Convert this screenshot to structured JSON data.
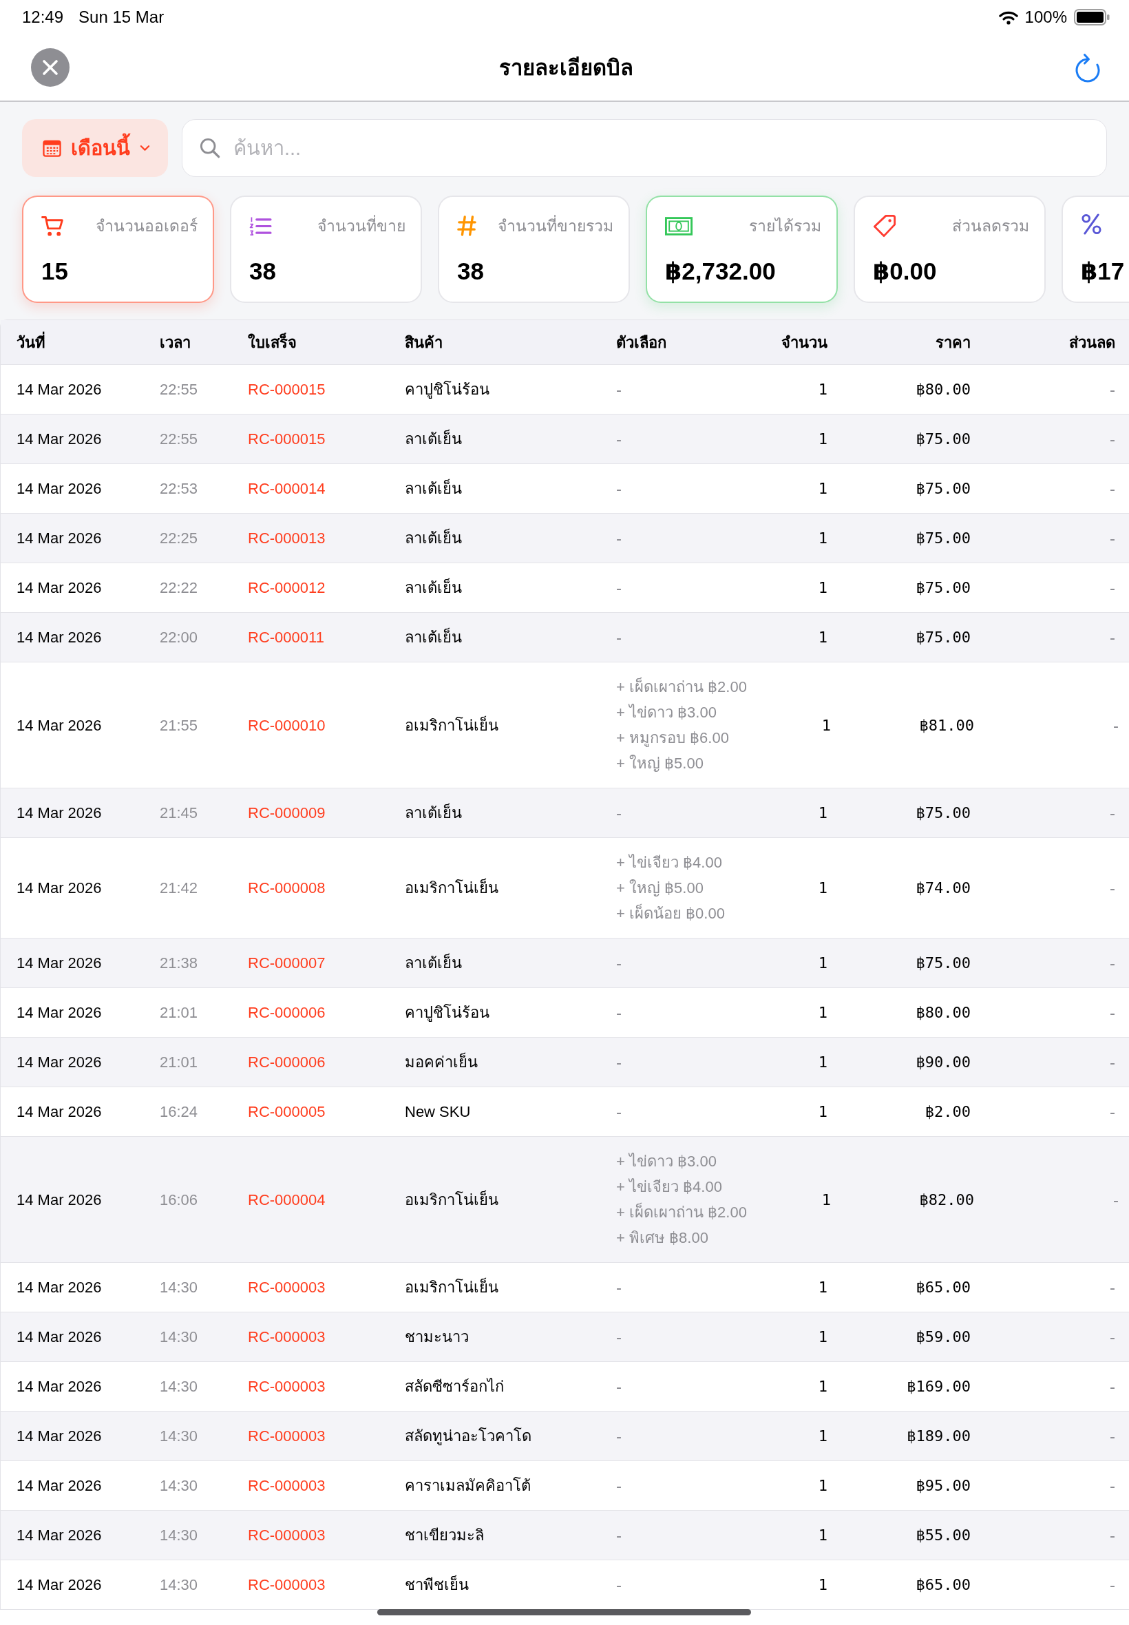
{
  "status_bar": {
    "time": "12:49",
    "date": "Sun 15 Mar",
    "battery": "100%"
  },
  "header": {
    "title": "รายละเอียดบิล"
  },
  "filter_button": {
    "label": "เดือนนี้"
  },
  "search": {
    "placeholder": "ค้นหา..."
  },
  "summary_cards": [
    {
      "kind": "cart",
      "label": "จำนวนออเดอร์",
      "value": "15",
      "color": "#ff3d1e",
      "highlighted": true
    },
    {
      "kind": "list",
      "label": "จำนวนที่ขาย",
      "value": "38",
      "color": "#af52de",
      "highlighted": false
    },
    {
      "kind": "hash",
      "label": "จำนวนที่ขายรวม",
      "value": "38",
      "color": "#ff9500",
      "highlighted": false
    },
    {
      "kind": "banknote",
      "label": "รายได้รวม",
      "value": "฿2,732.00",
      "color": "#34c759",
      "highlighted": true
    },
    {
      "kind": "tag",
      "label": "ส่วนลดรวม",
      "value": "฿0.00",
      "color": "#ff3b30",
      "highlighted": false
    },
    {
      "kind": "percent",
      "value": "฿17",
      "color": "#5856d6",
      "highlighted": false
    }
  ],
  "table": {
    "columns": [
      "วันที่",
      "เวลา",
      "ใบเสร็จ",
      "สินค้า",
      "ตัวเลือก",
      "จำนวน",
      "ราคา",
      "ส่วนลด"
    ],
    "rows": [
      {
        "date": "14 Mar 2026",
        "time": "22:55",
        "receipt": "RC-000015",
        "product": "คาปูชิโน่ร้อน",
        "options": "-",
        "quantity": "1",
        "price": "฿80.00",
        "discount": "-"
      },
      {
        "date": "14 Mar 2026",
        "time": "22:55",
        "receipt": "RC-000015",
        "product": "ลาเต้เย็น",
        "options": "-",
        "quantity": "1",
        "price": "฿75.00",
        "discount": "-"
      },
      {
        "date": "14 Mar 2026",
        "time": "22:53",
        "receipt": "RC-000014",
        "product": "ลาเต้เย็น",
        "options": "-",
        "quantity": "1",
        "price": "฿75.00",
        "discount": "-"
      },
      {
        "date": "14 Mar 2026",
        "time": "22:25",
        "receipt": "RC-000013",
        "product": "ลาเต้เย็น",
        "options": "-",
        "quantity": "1",
        "price": "฿75.00",
        "discount": "-"
      },
      {
        "date": "14 Mar 2026",
        "time": "22:22",
        "receipt": "RC-000012",
        "product": "ลาเต้เย็น",
        "options": "-",
        "quantity": "1",
        "price": "฿75.00",
        "discount": "-"
      },
      {
        "date": "14 Mar 2026",
        "time": "22:00",
        "receipt": "RC-000011",
        "product": "ลาเต้เย็น",
        "options": "-",
        "quantity": "1",
        "price": "฿75.00",
        "discount": "-"
      },
      {
        "date": "14 Mar 2026",
        "time": "21:55",
        "receipt": "RC-000010",
        "product": "อเมริกาโน่เย็น",
        "options": [
          "+ เผ็ดเผาถ่าน ฿2.00",
          "+ ไข่ดาว ฿3.00",
          "+ หมูกรอบ ฿6.00",
          "+ ใหญ่ ฿5.00"
        ],
        "quantity": "1",
        "price": "฿81.00",
        "discount": "-"
      },
      {
        "date": "14 Mar 2026",
        "time": "21:45",
        "receipt": "RC-000009",
        "product": "ลาเต้เย็น",
        "options": "-",
        "quantity": "1",
        "price": "฿75.00",
        "discount": "-"
      },
      {
        "date": "14 Mar 2026",
        "time": "21:42",
        "receipt": "RC-000008",
        "product": "อเมริกาโน่เย็น",
        "options": [
          "+ ไข่เจียว ฿4.00",
          "+ ใหญ่ ฿5.00",
          "+ เผ็ดน้อย ฿0.00"
        ],
        "quantity": "1",
        "price": "฿74.00",
        "discount": "-"
      },
      {
        "date": "14 Mar 2026",
        "time": "21:38",
        "receipt": "RC-000007",
        "product": "ลาเต้เย็น",
        "options": "-",
        "quantity": "1",
        "price": "฿75.00",
        "discount": "-"
      },
      {
        "date": "14 Mar 2026",
        "time": "21:01",
        "receipt": "RC-000006",
        "product": "คาปูชิโน่ร้อน",
        "options": "-",
        "quantity": "1",
        "price": "฿80.00",
        "discount": "-"
      },
      {
        "date": "14 Mar 2026",
        "time": "21:01",
        "receipt": "RC-000006",
        "product": "มอคค่าเย็น",
        "options": "-",
        "quantity": "1",
        "price": "฿90.00",
        "discount": "-"
      },
      {
        "date": "14 Mar 2026",
        "time": "16:24",
        "receipt": "RC-000005",
        "product": "New SKU",
        "options": "-",
        "quantity": "1",
        "price": "฿2.00",
        "discount": "-"
      },
      {
        "date": "14 Mar 2026",
        "time": "16:06",
        "receipt": "RC-000004",
        "product": "อเมริกาโน่เย็น",
        "options": [
          "+ ไข่ดาว ฿3.00",
          "+ ไข่เจียว ฿4.00",
          "+ เผ็ดเผาถ่าน ฿2.00",
          "+ พิเศษ ฿8.00"
        ],
        "quantity": "1",
        "price": "฿82.00",
        "discount": "-"
      },
      {
        "date": "14 Mar 2026",
        "time": "14:30",
        "receipt": "RC-000003",
        "product": "อเมริกาโน่เย็น",
        "options": "-",
        "quantity": "1",
        "price": "฿65.00",
        "discount": "-"
      },
      {
        "date": "14 Mar 2026",
        "time": "14:30",
        "receipt": "RC-000003",
        "product": "ชามะนาว",
        "options": "-",
        "quantity": "1",
        "price": "฿59.00",
        "discount": "-"
      },
      {
        "date": "14 Mar 2026",
        "time": "14:30",
        "receipt": "RC-000003",
        "product": "สลัดซีซาร์อกไก่",
        "options": "-",
        "quantity": "1",
        "price": "฿169.00",
        "discount": "-"
      },
      {
        "date": "14 Mar 2026",
        "time": "14:30",
        "receipt": "RC-000003",
        "product": "สลัดทูน่าอะโวคาโด",
        "options": "-",
        "quantity": "1",
        "price": "฿189.00",
        "discount": "-"
      },
      {
        "date": "14 Mar 2026",
        "time": "14:30",
        "receipt": "RC-000003",
        "product": "คาราเมลมัคคิอาโต้",
        "options": "-",
        "quantity": "1",
        "price": "฿95.00",
        "discount": "-"
      },
      {
        "date": "14 Mar 2026",
        "time": "14:30",
        "receipt": "RC-000003",
        "product": "ชาเขียวมะลิ",
        "options": "-",
        "quantity": "1",
        "price": "฿55.00",
        "discount": "-"
      },
      {
        "date": "14 Mar 2026",
        "time": "14:30",
        "receipt": "RC-000003",
        "product": "ชาพีชเย็น",
        "options": "-",
        "quantity": "1",
        "price": "฿65.00",
        "discount": "-"
      }
    ]
  }
}
